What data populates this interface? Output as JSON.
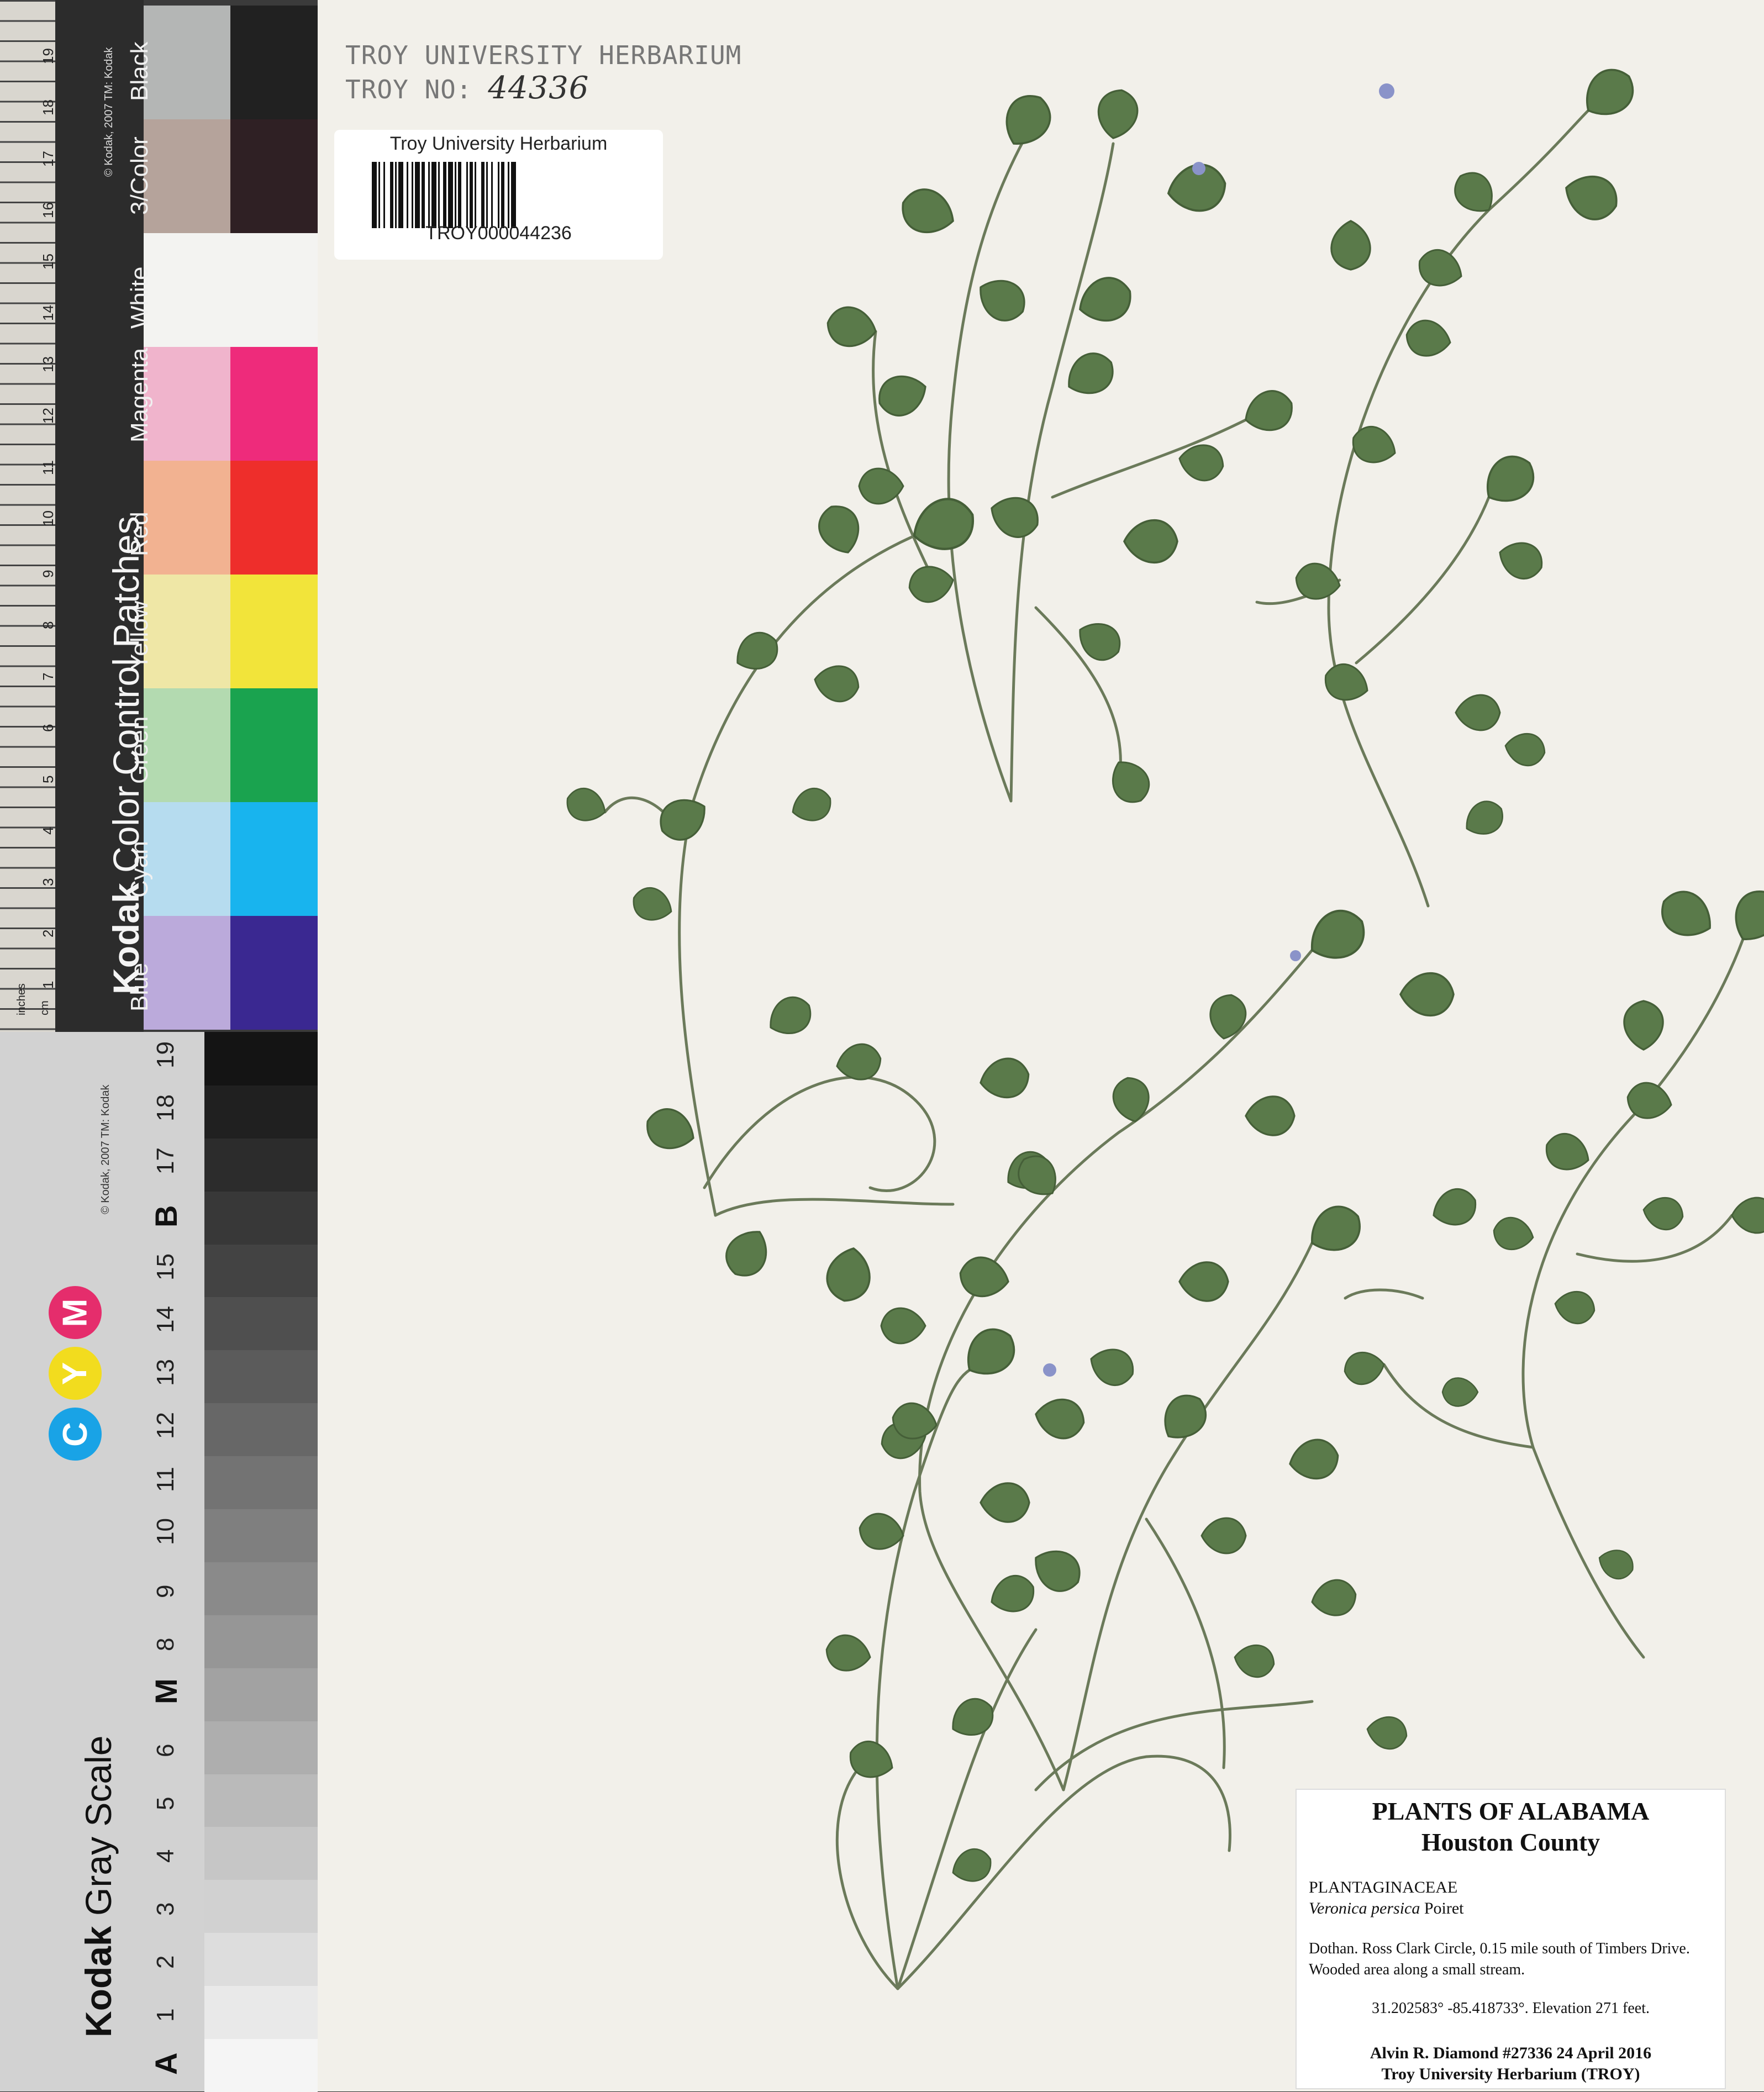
{
  "color_card": {
    "title_brand": "Kodak",
    "title_rest": " Color Control Patches",
    "copyright": "© Kodak, 2007 TM: Kodak",
    "patches": [
      {
        "name": "Black",
        "light": "#b4b6b5",
        "dark": "#212121"
      },
      {
        "name": "3/Color",
        "light": "#b5a39b",
        "dark": "#2f2024"
      },
      {
        "name": "White",
        "light": "#f3f3f1",
        "dark": "#f3f3f1"
      },
      {
        "name": "Magenta",
        "light": "#f0b4cc",
        "dark": "#ee2b7b"
      },
      {
        "name": "Red",
        "light": "#f2b291",
        "dark": "#ee2e2b"
      },
      {
        "name": "Yellow",
        "light": "#efe7a6",
        "dark": "#f2e43a"
      },
      {
        "name": "Green",
        "light": "#b3dab0",
        "dark": "#1aa34f"
      },
      {
        "name": "Cyan",
        "light": "#b6dcef",
        "dark": "#18b4ee"
      },
      {
        "name": "Blue",
        "light": "#bbaadb",
        "dark": "#3a2891"
      }
    ],
    "ruler_numbers": [
      "1",
      "2",
      "3",
      "4",
      "5",
      "6",
      "7",
      "8",
      "9",
      "10",
      "11",
      "12",
      "13",
      "14",
      "15",
      "16",
      "17",
      "18",
      "19"
    ],
    "ruler_units": [
      "inches",
      "cm"
    ]
  },
  "gray_card": {
    "title_brand": "Kodak",
    "title_rest": " Gray Scale",
    "copyright": "© Kodak, 2007 TM: Kodak",
    "cym": [
      "C",
      "Y",
      "M"
    ],
    "cym_colors": [
      "#19a3e6",
      "#f2dc1e",
      "#e52d6c"
    ],
    "scale_labels": [
      "A",
      "1",
      "2",
      "3",
      "4",
      "5",
      "6",
      "M",
      "8",
      "9",
      "10",
      "11",
      "12",
      "13",
      "14",
      "15",
      "B",
      "17",
      "18",
      "19"
    ]
  },
  "stamp": {
    "line1": "TROY UNIVERSITY HERBARIUM",
    "line2_prefix": "TROY NO:",
    "line2_number": "44336"
  },
  "barcode": {
    "title": "Troy University Herbarium",
    "id": "TROY000044236"
  },
  "label": {
    "title": "PLANTS OF ALABAMA",
    "county": "Houston County",
    "family": "PLANTAGINACEAE",
    "species": "Veronica persica",
    "author": " Poiret",
    "locality1": "Dothan. Ross Clark Circle, 0.15 mile south of Timbers Drive.",
    "locality2": "Wooded area along a small stream.",
    "coordinates": "31.202583°  -85.418733°. Elevation 271 feet.",
    "collector": "Alvin R. Diamond #27336    24 April 2016",
    "institution": "Troy University Herbarium (TROY)"
  }
}
